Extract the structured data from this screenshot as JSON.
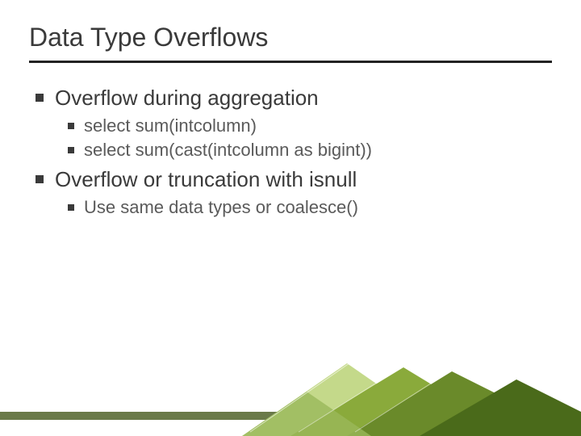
{
  "slide": {
    "title": "Data Type Overflows",
    "bullets": [
      {
        "level": 1,
        "text": "Overflow during aggregation",
        "children": [
          {
            "level": 2,
            "text": "select sum(intcolumn)"
          },
          {
            "level": 2,
            "text": "select sum(cast(intcolumn as bigint))"
          }
        ]
      },
      {
        "level": 1,
        "text": "Overflow or truncation with isnull",
        "children": [
          {
            "level": 2,
            "text": "Use same data types or coalesce()"
          }
        ]
      }
    ]
  },
  "colors": {
    "accent_green": "#8aaa3b",
    "dark_green": "#4a6a1a",
    "light_green": "#c4d98a",
    "bar": "#6a7a4a"
  }
}
